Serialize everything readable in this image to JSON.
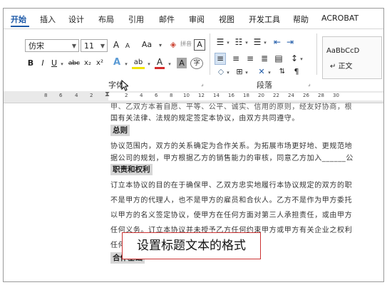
{
  "tabs": [
    "开始",
    "插入",
    "设计",
    "布局",
    "引用",
    "邮件",
    "审阅",
    "视图",
    "开发工具",
    "帮助",
    "ACROBAT"
  ],
  "font": {
    "name": "仿宋",
    "size": "11"
  },
  "ribbon": {
    "grow_font": "A",
    "shrink_font": "A",
    "change_case": "Aa",
    "phonetic": "拼音",
    "border_char": "A",
    "bold": "B",
    "italic": "I",
    "underline": "U",
    "strikethrough": "abc",
    "subscript": "x₂",
    "superscript": "x²",
    "text_effect": "A",
    "highlight": "ab",
    "font_color": "A",
    "char_shading": "A",
    "enclose": "字",
    "font_group_label": "字体",
    "paragraph_group_label": "段落",
    "style_sample": "AaBbCcD",
    "style_name": "正文"
  },
  "ruler_ticks_left": [
    "8",
    "6",
    "4",
    "2"
  ],
  "ruler_ticks_right": [
    "2",
    "4",
    "6",
    "8",
    "10",
    "12",
    "14",
    "16",
    "18",
    "20",
    "22",
    "24",
    "26",
    "28",
    "30"
  ],
  "document": {
    "line0": "甲、乙双方本着自愿、平等、公平、诚实、信用的原则，经友好协商，根",
    "line1": "国有关法律、法规的规定签定本协议，由双方共同遵守。",
    "heading1": "总则",
    "line2": "协议范围内，双方的关系确定为合作关系。为拓展市场更好地、更规范地",
    "line3": "据公司的规划，甲方根据乙方的销售能力的审核，同意乙方加入______公",
    "heading2": "职责和权利",
    "line4": "订立本协议的目的在于确保甲、乙双方忠实地履行本协议规定的双方的职",
    "line5": "不是甲方的代理人，也不是甲方的雇员和合伙人。乙方不是作为甲方委托",
    "line6": "以甲方的名义签定协议，使甲方在任何方面对第三人承担责任，或由甲方",
    "line7": "任何义务。订立本协议并未授予乙方任何约束甲方或甲方有关企业之权利",
    "line8": "任何",
    "heading3": "合作基础"
  },
  "callout": "设置标题文本的格式",
  "colors": {
    "accent": "#1e5aa8",
    "highlight_gray": "#d6d6d6",
    "callout_border": "#cc3333"
  }
}
